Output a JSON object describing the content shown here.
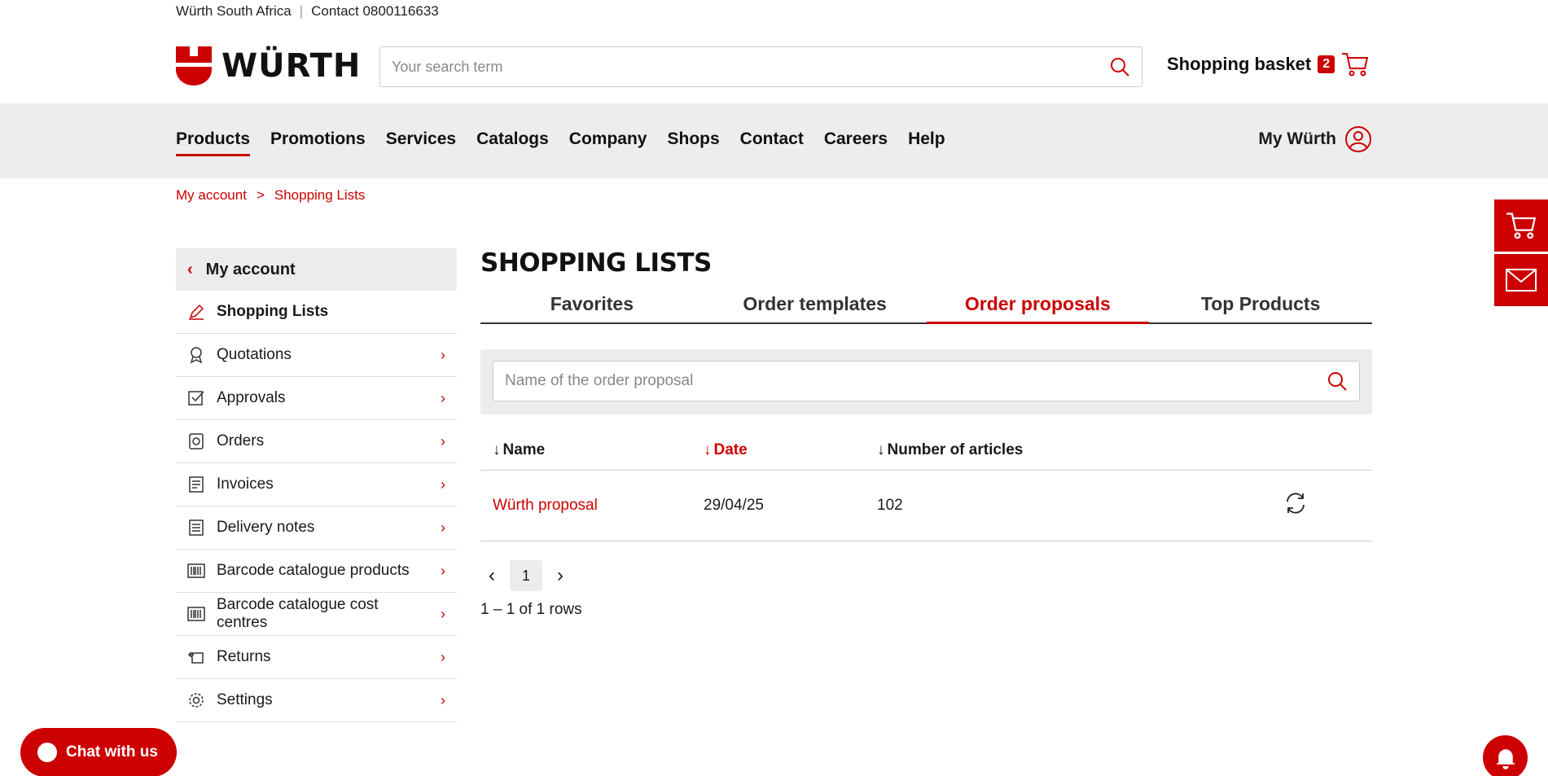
{
  "topbar": {
    "company": "Würth South Africa",
    "contact": "Contact 0800116633"
  },
  "header": {
    "logo_text": "WÜRTH",
    "search_placeholder": "Your search term",
    "basket_label": "Shopping basket",
    "basket_count": "2"
  },
  "nav": {
    "items": [
      "Products",
      "Promotions",
      "Services",
      "Catalogs",
      "Company",
      "Shops",
      "Contact",
      "Careers",
      "Help"
    ],
    "active": "Products",
    "mywurth": "My Würth"
  },
  "breadcrumb": {
    "items": [
      "My account",
      "Shopping Lists"
    ],
    "sep": ">"
  },
  "sidebar": {
    "head": "My account",
    "items": [
      {
        "label": "Shopping Lists",
        "icon": "pencil-icon"
      },
      {
        "label": "Quotations",
        "icon": "award-icon"
      },
      {
        "label": "Approvals",
        "icon": "checkbox-icon"
      },
      {
        "label": "Orders",
        "icon": "orders-icon"
      },
      {
        "label": "Invoices",
        "icon": "invoice-icon"
      },
      {
        "label": "Delivery notes",
        "icon": "delivery-note-icon"
      },
      {
        "label": "Barcode catalogue products",
        "icon": "barcode-icon"
      },
      {
        "label": "Barcode catalogue cost centres",
        "icon": "barcode-icon"
      },
      {
        "label": "Returns",
        "icon": "returns-icon"
      },
      {
        "label": "Settings",
        "icon": "gear-icon"
      }
    ]
  },
  "main": {
    "title": "SHOPPING LISTS",
    "tabs": [
      "Favorites",
      "Order templates",
      "Order proposals",
      "Top Products"
    ],
    "active_tab": "Order proposals",
    "filter_placeholder": "Name of the order proposal",
    "columns": [
      "Name",
      "Date",
      "Number of articles"
    ],
    "rows": [
      {
        "name": "Würth proposal",
        "date": "29/04/25",
        "articles": "102"
      }
    ],
    "page": "1",
    "rows_info": "1 – 1 of 1 rows"
  },
  "chat_label": "Chat with us",
  "colors": {
    "brand": "#cc0000",
    "nav_bg": "#ededed"
  }
}
